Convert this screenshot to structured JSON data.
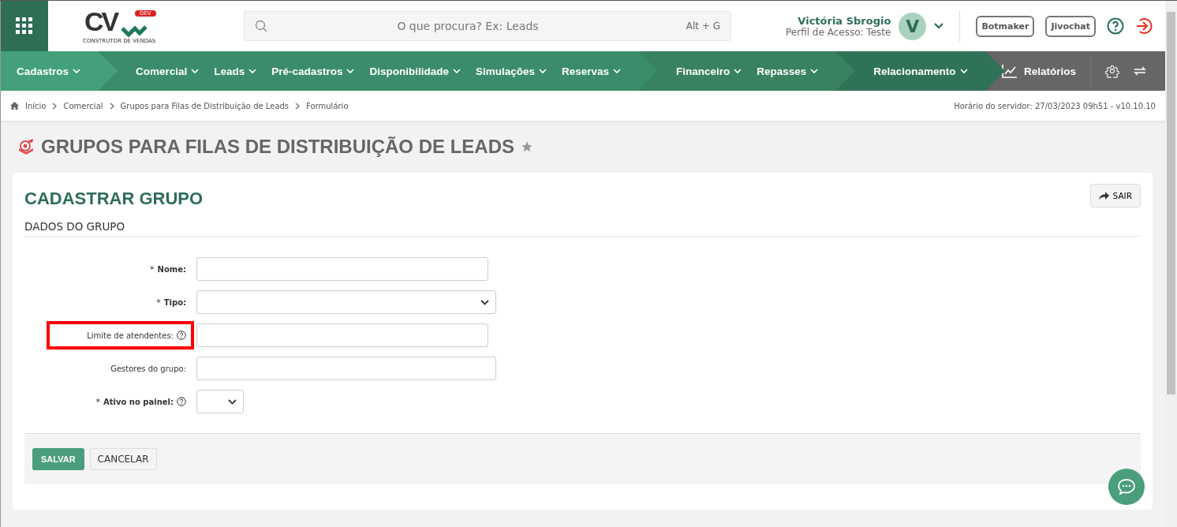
{
  "header": {
    "logo": {
      "letters": "CV",
      "badge": "DEV",
      "tagline": "CONSTRUTOR DE VENDAS"
    },
    "search": {
      "placeholder": "O que procura? Ex: Leads",
      "shortcut": "Alt + G"
    },
    "user": {
      "name": "Victória Sbrogio",
      "profile": "Perfil de Acesso: Teste",
      "initial": "V"
    },
    "buttons": [
      "Botmaker",
      "Jivochat"
    ]
  },
  "nav": {
    "groups": [
      {
        "color": "#43a07a",
        "items": [
          "Cadastros"
        ]
      },
      {
        "color": "#3b8c6a",
        "items": [
          "Comercial",
          "Leads",
          "Pré-cadastros",
          "Disponibilidade",
          "Simulações",
          "Reservas"
        ]
      },
      {
        "color": "#38825f",
        "items": [
          "Financeiro",
          "Repasses"
        ]
      },
      {
        "color": "#2f7257",
        "items": [
          "Relacionamento"
        ]
      }
    ],
    "reports": "Relatórios"
  },
  "breadcrumb": [
    "Início",
    "Comercial",
    "Grupos para Filas de Distribuição de Leads",
    "Formulário"
  ],
  "server_time": "Horário do servidor: 27/03/2023 09h51 - v10.10.10",
  "page_title": "GRUPOS PARA FILAS DE DISTRIBUIÇÃO DE LEADS",
  "card": {
    "title": "CADASTRAR GRUPO",
    "exit_button": "SAIR",
    "section": "DADOS DO GRUPO",
    "fields": [
      {
        "marker": "*",
        "label": "Nome:",
        "kind": "text",
        "required": true,
        "help": false,
        "highlighted": false
      },
      {
        "marker": "*",
        "label": "Tipo:",
        "kind": "select",
        "required": true,
        "help": false,
        "highlighted": false
      },
      {
        "label": "Limite de atendentes:",
        "kind": "text",
        "required": false,
        "help": true,
        "highlighted": true
      },
      {
        "label": "Gestores do grupo:",
        "kind": "picker",
        "required": false,
        "help": false,
        "highlighted": false
      },
      {
        "marker": "*",
        "label": "Ativo no painel:",
        "kind": "small-select",
        "required": true,
        "help": true,
        "highlighted": false
      }
    ],
    "save_button": "SALVAR",
    "cancel_button": "CANCELAR"
  }
}
